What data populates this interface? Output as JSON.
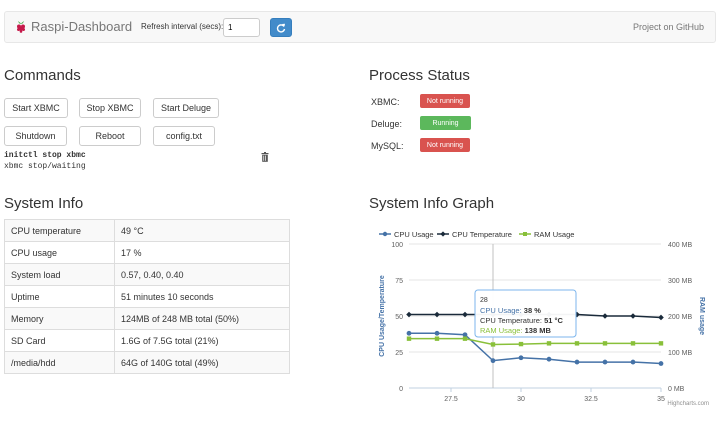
{
  "navbar": {
    "brand": "Raspi-Dashboard",
    "refresh_label": "Refresh interval (secs):",
    "refresh_value": "1",
    "github_label": "Project on GitHub"
  },
  "commands": {
    "title": "Commands",
    "buttons": [
      "Start XBMC",
      "Stop XBMC",
      "Start Deluge",
      "Shutdown",
      "Reboot",
      "config.txt"
    ],
    "output_cmd": "initctl stop xbmc",
    "output_result": "xbmc stop/waiting"
  },
  "process_status": {
    "title": "Process Status",
    "items": [
      {
        "label": "XBMC:",
        "status": "Not running",
        "color": "#d9534f"
      },
      {
        "label": "Deluge:",
        "status": "Running",
        "color": "#5cb85c"
      },
      {
        "label": "MySQL:",
        "status": "Not running",
        "color": "#d9534f"
      }
    ]
  },
  "system_info": {
    "title": "System Info",
    "rows": [
      {
        "key": "CPU temperature",
        "value": "49 °C"
      },
      {
        "key": "CPU usage",
        "value": "17 %"
      },
      {
        "key": "System load",
        "value": "0.57, 0.40, 0.40"
      },
      {
        "key": "Uptime",
        "value": "51 minutes 10 seconds"
      },
      {
        "key": "Memory",
        "value": "124MB of 248 MB total (50%)"
      },
      {
        "key": "SD Card",
        "value": "1.6G of 7.5G total (21%)"
      },
      {
        "key": "/media/hdd",
        "value": "64G of 140G total (49%)"
      }
    ]
  },
  "graph": {
    "title": "System Info Graph",
    "credit": "Highcharts.com"
  },
  "chart_data": {
    "type": "line",
    "x": [
      26,
      27,
      28,
      29,
      30,
      31,
      32,
      33,
      34,
      35
    ],
    "xticks": [
      27.5,
      30,
      32.5,
      35
    ],
    "xlim": [
      26,
      35
    ],
    "series": [
      {
        "name": "CPU Usage",
        "color": "#4572A7",
        "axis": "left",
        "marker": "circle",
        "values": [
          38,
          38,
          37,
          19,
          21,
          20,
          18,
          18,
          18,
          17
        ]
      },
      {
        "name": "CPU Temperature",
        "color": "#1a2a3a",
        "axis": "left",
        "marker": "diamond",
        "values": [
          51,
          51,
          51,
          51,
          51,
          51,
          51,
          50,
          50,
          49
        ]
      },
      {
        "name": "RAM Usage",
        "color": "#89c03a",
        "axis": "right",
        "marker": "square",
        "values": [
          137,
          137,
          137,
          121,
          122,
          124,
          124,
          124,
          124,
          124
        ]
      }
    ],
    "yleft": {
      "label": "CPU Usage/Temperature",
      "ticks": [
        "0",
        "25",
        "50",
        "75",
        "100"
      ],
      "lim": [
        0,
        100
      ]
    },
    "yright": {
      "label": "RAM usage",
      "ticks": [
        "0 MB",
        "100 MB",
        "200 MB",
        "300 MB",
        "400 MB"
      ],
      "lim": [
        0,
        400
      ]
    },
    "legend": "top",
    "tooltip": {
      "header": "28",
      "rows": [
        {
          "name": "CPU Usage",
          "value": "38 %"
        },
        {
          "name": "CPU Temperature",
          "value": "51 °C"
        },
        {
          "name": "RAM Usage",
          "value": "138 MB"
        }
      ]
    },
    "crosshair_x": 29
  }
}
